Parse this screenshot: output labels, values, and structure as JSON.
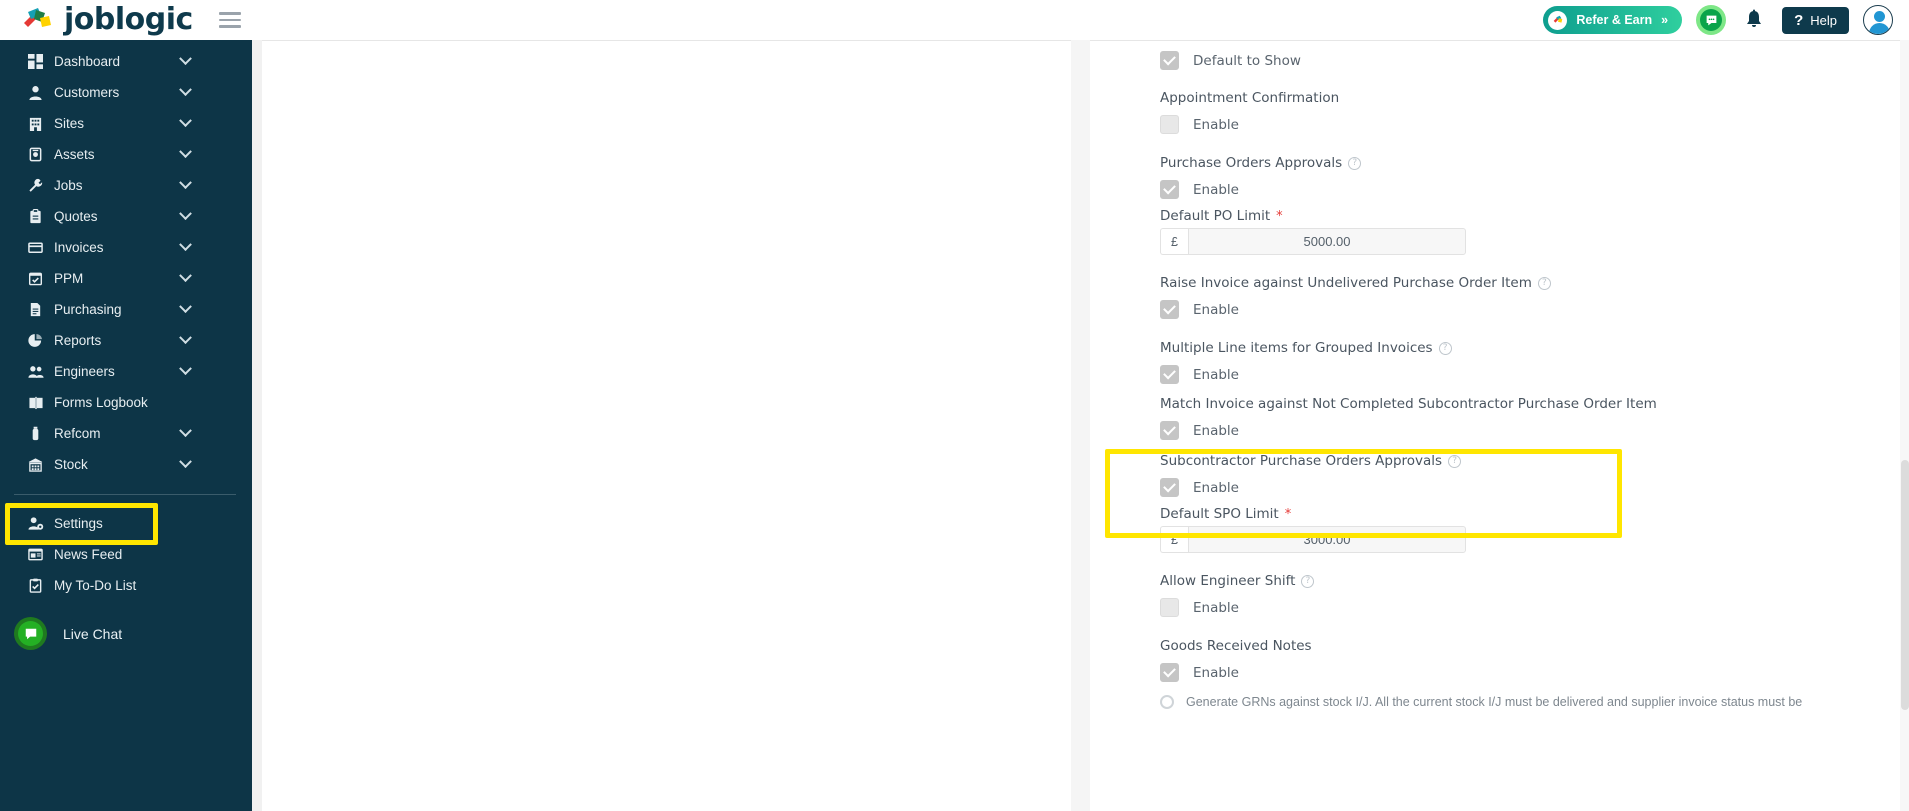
{
  "app": {
    "brand": "joblogic",
    "accent_navy": "#0d3547",
    "highlight_yellow": "#ffe600"
  },
  "topbar": {
    "menu_icon": "hamburger-icon",
    "refer_label": "Refer & Earn",
    "refer_chevrons": "»",
    "chat_icon": "chat-bubble-icon",
    "bell_icon": "notification-bell-icon",
    "help_label": "Help",
    "help_icon": "question-mark-icon",
    "avatar_icon": "user-avatar-icon"
  },
  "sidebar": {
    "items": [
      {
        "label": "Dashboard",
        "icon": "dashboard-icon",
        "expandable": true
      },
      {
        "label": "Customers",
        "icon": "person-icon",
        "expandable": true
      },
      {
        "label": "Sites",
        "icon": "building-icon",
        "expandable": true
      },
      {
        "label": "Assets",
        "icon": "asset-tag-icon",
        "expandable": true
      },
      {
        "label": "Jobs",
        "icon": "wrench-icon",
        "expandable": true
      },
      {
        "label": "Quotes",
        "icon": "clipboard-icon",
        "expandable": true
      },
      {
        "label": "Invoices",
        "icon": "invoice-card-icon",
        "expandable": true
      },
      {
        "label": "PPM",
        "icon": "calendar-check-icon",
        "expandable": true
      },
      {
        "label": "Purchasing",
        "icon": "document-icon",
        "expandable": true
      },
      {
        "label": "Reports",
        "icon": "pie-chart-icon",
        "expandable": true
      },
      {
        "label": "Engineers",
        "icon": "people-icon",
        "expandable": true
      },
      {
        "label": "Forms Logbook",
        "icon": "book-icon",
        "expandable": false
      },
      {
        "label": "Refcom",
        "icon": "cylinder-icon",
        "expandable": true
      },
      {
        "label": "Stock",
        "icon": "warehouse-icon",
        "expandable": true
      }
    ],
    "secondary_items": [
      {
        "label": "Settings",
        "icon": "person-gear-icon",
        "highlighted": true
      },
      {
        "label": "News Feed",
        "icon": "newspaper-icon",
        "highlighted": false
      },
      {
        "label": "My To-Do List",
        "icon": "checklist-icon",
        "highlighted": false
      }
    ],
    "live_chat": {
      "label": "Live Chat",
      "icon": "live-chat-icon"
    }
  },
  "settings_form": {
    "fields": [
      {
        "id": "default-to-show",
        "label": "",
        "help": false,
        "checkbox_label": "Default to Show",
        "checked": true
      },
      {
        "id": "appointment-confirmation",
        "label": "Appointment Confirmation",
        "help": false,
        "checkbox_label": "Enable",
        "checked": false
      },
      {
        "id": "purchase-orders-approvals",
        "label": "Purchase Orders Approvals",
        "help": true,
        "checkbox_label": "Enable",
        "checked": true,
        "sub_label": "Default PO Limit",
        "sub_required": true,
        "currency": "£",
        "amount": "5000.00"
      },
      {
        "id": "raise-invoice-undelivered-po-item",
        "label": "Raise Invoice against Undelivered Purchase Order Item",
        "help": true,
        "checkbox_label": "Enable",
        "checked": true
      },
      {
        "id": "multiple-line-items-grouped-invoices",
        "label": "Multiple Line items for Grouped Invoices",
        "help": true,
        "checkbox_label": "Enable",
        "checked": true
      },
      {
        "id": "match-invoice-not-completed-spo-item",
        "label": "Match Invoice against Not Completed Subcontractor Purchase Order Item",
        "help": false,
        "checkbox_label": "Enable",
        "checked": true,
        "highlighted": true
      },
      {
        "id": "subcontractor-purchase-orders-approvals",
        "label": "Subcontractor Purchase Orders Approvals",
        "help": true,
        "checkbox_label": "Enable",
        "checked": true,
        "sub_label": "Default SPO Limit",
        "sub_required": true,
        "currency": "£",
        "amount": "3000.00"
      },
      {
        "id": "allow-engineer-shift",
        "label": "Allow Engineer Shift",
        "help": true,
        "checkbox_label": "Enable",
        "checked": false
      },
      {
        "id": "goods-received-notes",
        "label": "Goods Received Notes",
        "help": false,
        "checkbox_label": "Enable",
        "checked": true,
        "cut_off_text": "Generate GRNs against stock I/J. All the current stock I/J must be delivered and supplier invoice status must be"
      }
    ]
  }
}
